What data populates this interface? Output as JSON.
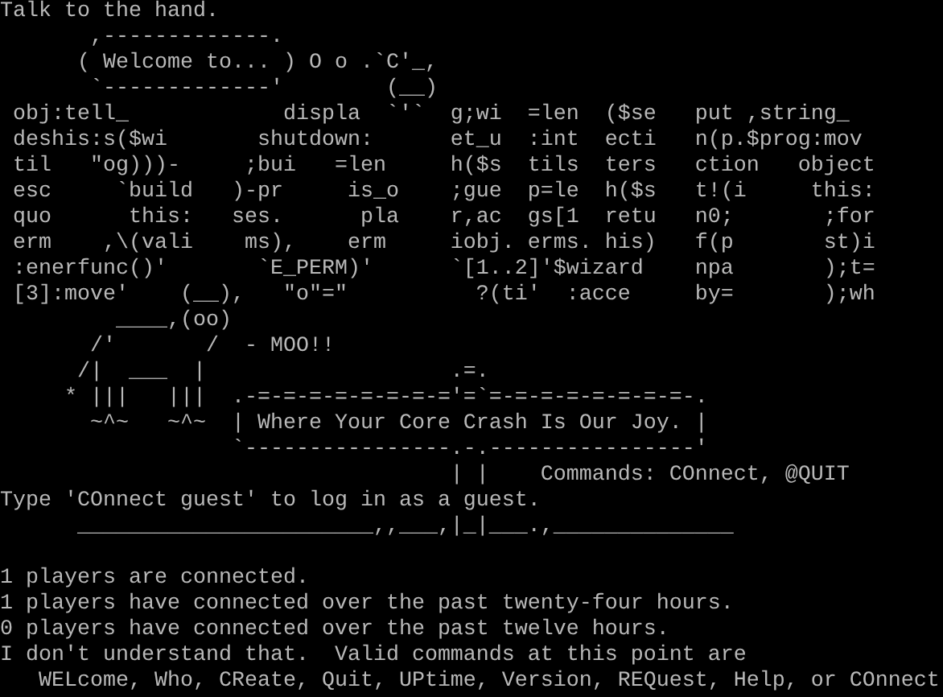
{
  "terminal": {
    "blocks": [
      {
        "lines": [
          "Talk to the hand.",
          "       ,-------------.",
          "      ( Welcome to... ) O o .`C'_,",
          "       `-------------'        (__)",
          " obj:tell_            displa  `'`  g;wi  =len  ($se   put ,string_",
          " deshis:s($wi       shutdown:      et_u  :int  ecti   n(p.$prog:mov",
          " til   \"og)))-     ;bui   =len     h($s  tils  ters   ction   object",
          " esc     `build   )-pr     is_o    ;gue  p=le  h($s   t!(i     this:",
          " quo      this:   ses.      pla    r,ac  gs[1  retu   n0;       ;for",
          " erm    ,\\(vali    ms),    erm     iobj. erms. his)   f(p       st)i",
          " :enerfunc()'       `E_PERM)'      `[1..2]'$wizard    npa       );t=",
          " [3]:move'    (__),   \"o\"=\"          ?(ti'  :acce     by=       );wh",
          "         ____,(oo)",
          "       /'       /  - MOO!!",
          "      /|  ___  |                   .=.",
          "     * |||   |||  .-=-=-=-=-=-=-=-='=`=-=-=-=-=-=-=-=-.",
          "       ~^~   ~^~  | Where Your Core Crash Is Our Joy. |",
          "                  `----------------.-.----------------'",
          "                                   | |    Commands: COnnect, @QUIT",
          "Type 'COnnect guest' to log in as a guest.",
          "      _______________________,,___,|_|___.,______________"
        ]
      },
      {
        "lines": [
          "1 players are connected.",
          "1 players have connected over the past twenty-four hours.",
          "0 players have connected over the past twelve hours.",
          "I don't understand that.  Valid commands at this point are",
          "   WELcome, Who, CReate, Quit, UPtime, Version, REQuest, Help, or COnnect"
        ]
      }
    ]
  }
}
